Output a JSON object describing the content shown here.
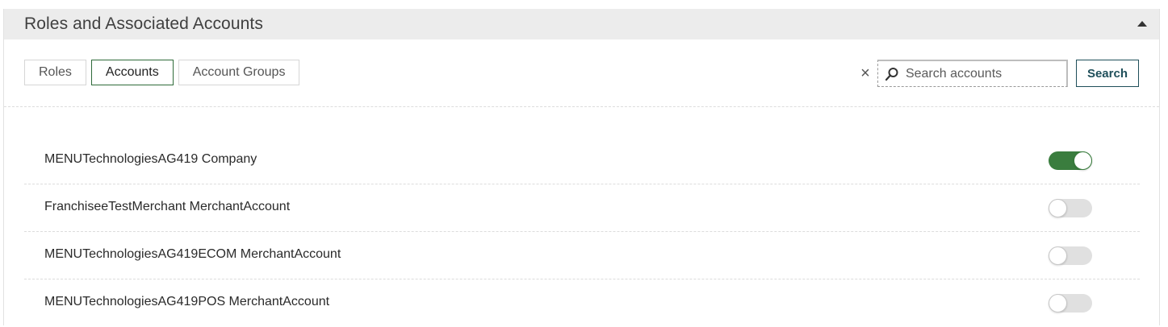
{
  "panel": {
    "title": "Roles and Associated Accounts"
  },
  "tabs": [
    {
      "label": "Roles",
      "active": false
    },
    {
      "label": "Accounts",
      "active": true
    },
    {
      "label": "Account Groups",
      "active": false
    }
  ],
  "search": {
    "clear_symbol": "×",
    "placeholder": "Search accounts",
    "value": "",
    "button_label": "Search"
  },
  "accounts": [
    {
      "name": "MENUTechnologiesAG419 Company",
      "enabled": true
    },
    {
      "name": "FranchiseeTestMerchant MerchantAccount",
      "enabled": false
    },
    {
      "name": "MENUTechnologiesAG419ECOM MerchantAccount",
      "enabled": false
    },
    {
      "name": "MENUTechnologiesAG419POS MerchantAccount",
      "enabled": false
    }
  ],
  "colors": {
    "header_bg": "#ececec",
    "active_tab_border": "#2f6b3a",
    "toggle_on": "#3a7d3e",
    "toggle_off": "#e0e0e0",
    "search_button": "#1f4f5a"
  },
  "icons": {
    "clear": "close-icon",
    "search": "search-icon",
    "collapse": "caret-up-icon"
  }
}
